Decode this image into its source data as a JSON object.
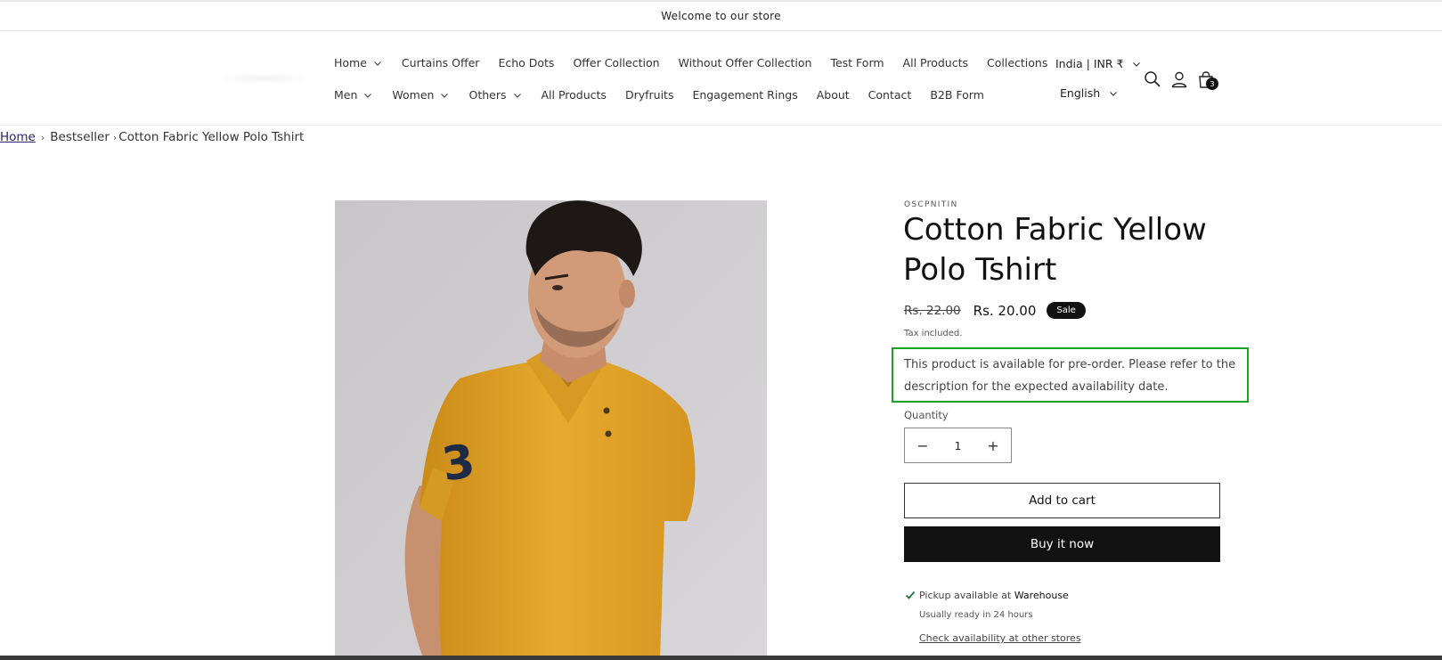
{
  "announcement": {
    "text": "Welcome to our store"
  },
  "nav": {
    "row1": [
      {
        "label": "Home",
        "dropdown": true
      },
      {
        "label": "Curtains Offer",
        "dropdown": false
      },
      {
        "label": "Echo Dots",
        "dropdown": false
      },
      {
        "label": "Offer Collection",
        "dropdown": false
      },
      {
        "label": "Without Offer Collection",
        "dropdown": false
      },
      {
        "label": "Test Form",
        "dropdown": false
      },
      {
        "label": "All Products",
        "dropdown": false
      },
      {
        "label": "Collections",
        "dropdown": false
      }
    ],
    "row2": [
      {
        "label": "Men",
        "dropdown": true
      },
      {
        "label": "Women",
        "dropdown": true
      },
      {
        "label": "Others",
        "dropdown": true
      },
      {
        "label": "All Products",
        "dropdown": false
      },
      {
        "label": "Dryfruits",
        "dropdown": false
      },
      {
        "label": "Engagement Rings",
        "dropdown": false
      },
      {
        "label": "About",
        "dropdown": false
      },
      {
        "label": "Contact",
        "dropdown": false
      },
      {
        "label": "B2B Form",
        "dropdown": false
      }
    ]
  },
  "locale": {
    "country": "India | INR ₹",
    "language": "English"
  },
  "header_icons": [
    "search-icon",
    "account-icon",
    "cart-icon"
  ],
  "cart": {
    "count": "3"
  },
  "breadcrumb": {
    "home": "Home",
    "parent": "Bestseller",
    "separator": "›",
    "current": "Cotton Fabric Yellow Polo Tshirt"
  },
  "product": {
    "vendor": "OSCPNITIN",
    "title": "Cotton Fabric Yellow Polo Tshirt",
    "price_regular": "Rs. 22.00",
    "price_sale": "Rs. 20.00",
    "badge": "Sale",
    "tax_note": "Tax included.",
    "preorder_message": "This product is available for pre-order. Please refer to the description for the expected availability date.",
    "quantity_label": "Quantity",
    "quantity": "1",
    "decrease": "−",
    "increase": "+",
    "add_to_cart": "Add to cart",
    "buy_now": "Buy it now",
    "image_jersey_number": "3"
  },
  "pickup": {
    "available_prefix": "Pickup available at",
    "location": "Warehouse",
    "ready_time": "Usually ready in 24 hours",
    "check_link": "Check availability at other stores"
  },
  "colors": {
    "preorder_outline": "#1aa322",
    "button_dark": "#121212",
    "pickup_check": "#1f7a3a",
    "shirt": "#e3a52a"
  }
}
